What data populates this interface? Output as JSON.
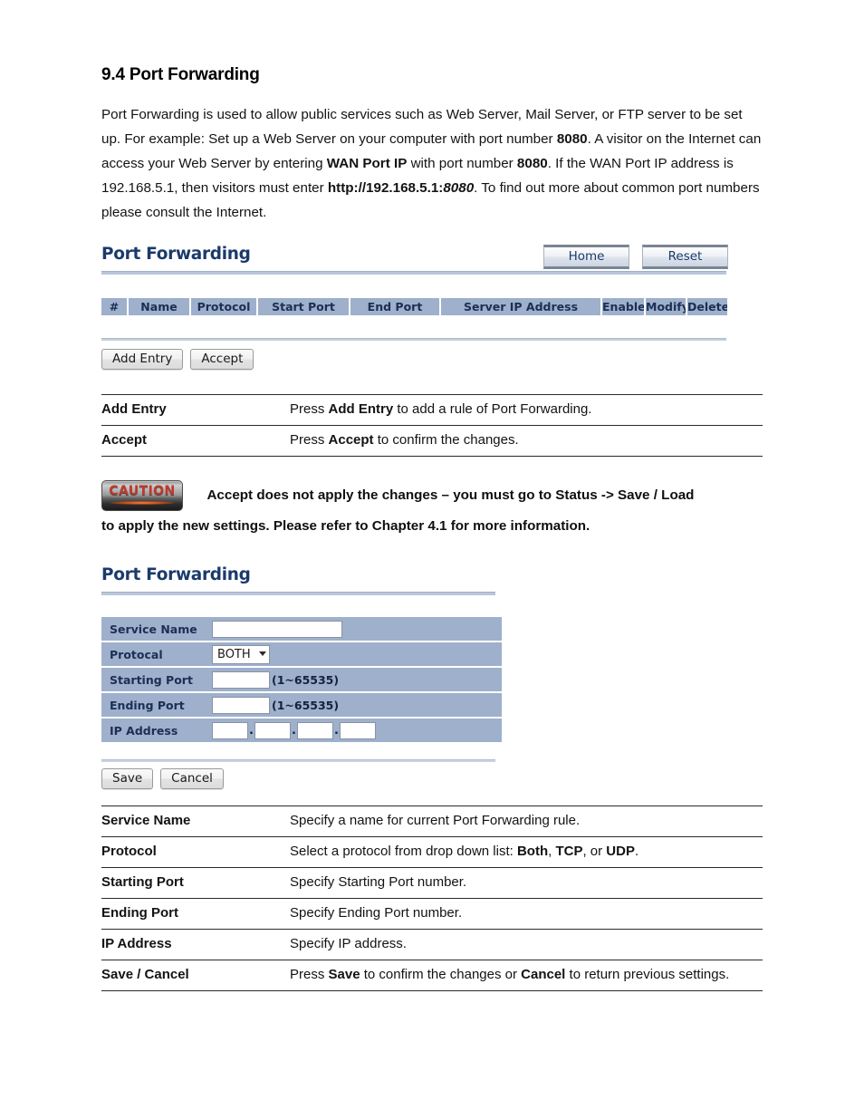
{
  "section": {
    "number": "9.4",
    "heading": "9.4 Port Forwarding",
    "paragraph_parts": {
      "p1": "Port Forwarding is used to allow public services such as Web Server, Mail Server, or FTP server to be set up. For example: Set up a Web Server on your computer with port number ",
      "b1": "8080",
      "p2": ". A visitor on the Internet can access your Web Server by entering ",
      "b2": "WAN Port IP",
      "p3": " with port number ",
      "b3": "8080",
      "p4": ". If the WAN Port IP address is 192.168.5.1, then visitors must enter ",
      "b4": "http://192.168.5.1:",
      "i4": "8080",
      "p5": ". To find out more about common port numbers please consult the Internet."
    }
  },
  "list_screenshot": {
    "title": "Port Forwarding",
    "buttons": {
      "home": "Home",
      "reset": "Reset"
    },
    "table_headers": [
      "#",
      "Name",
      "Protocol",
      "Start Port",
      "End Port",
      "Server IP Address",
      "Enable",
      "Modify",
      "Delete"
    ],
    "action_buttons": {
      "add_entry": "Add Entry",
      "accept": "Accept"
    }
  },
  "list_desc_table": {
    "rows": [
      {
        "key": "Add Entry",
        "value_parts": [
          "Press ",
          "Add Entry",
          " to add a rule of Port Forwarding."
        ]
      },
      {
        "key": "Accept",
        "value_parts": [
          "Press ",
          "Accept",
          " to confirm the changes."
        ]
      }
    ]
  },
  "caution": {
    "badge_label": "CAUTION",
    "line1": "Accept does not apply the changes – you must go to Status -> Save / Load",
    "line2": "to apply the new settings. Please refer to Chapter 4.1 for more information."
  },
  "form_screenshot": {
    "title": "Port Forwarding",
    "fields": [
      {
        "label": "Service Name",
        "type": "text",
        "value": "",
        "hint": ""
      },
      {
        "label": "Protocal",
        "type": "select",
        "value": "BOTH",
        "hint": ""
      },
      {
        "label": "Starting Port",
        "type": "text",
        "value": "",
        "hint": "(1~65535)"
      },
      {
        "label": "Ending Port",
        "type": "text",
        "value": "",
        "hint": "(1~65535)"
      },
      {
        "label": "IP Address",
        "type": "ip",
        "value": "",
        "hint": ""
      }
    ],
    "ip_octets": [
      "",
      "",
      "",
      ""
    ],
    "buttons": {
      "save": "Save",
      "cancel": "Cancel"
    }
  },
  "form_desc_table": {
    "rows": [
      {
        "key": "Service Name",
        "value_parts": [
          "Specify a name for current Port Forwarding rule."
        ]
      },
      {
        "key": "Protocol",
        "value_parts": [
          "Select a protocol from drop down list: ",
          "Both",
          ", ",
          "TCP",
          ", or ",
          "UDP",
          "."
        ]
      },
      {
        "key": "Starting Port",
        "value_parts": [
          "Specify Starting Port number."
        ]
      },
      {
        "key": "Ending Port",
        "value_parts": [
          "Specify Ending Port number."
        ]
      },
      {
        "key": "IP Address",
        "value_parts": [
          "Specify IP address."
        ]
      },
      {
        "key": "Save / Cancel",
        "value_parts": [
          "Press ",
          "Save",
          " to confirm the changes or ",
          "Cancel",
          " to return previous settings."
        ]
      }
    ]
  },
  "colors": {
    "ui_title": "#1b3a6b",
    "table_header_bg": "#9eb0cb",
    "table_header_text": "#1b2f56",
    "rule": "#b9c6da",
    "caution_red": "#c0392b"
  }
}
